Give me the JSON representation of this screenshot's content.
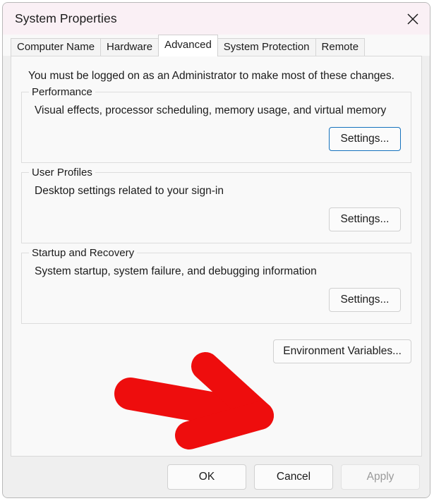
{
  "window": {
    "title": "System Properties",
    "close_icon": "close-icon"
  },
  "tabs": [
    {
      "label": "Computer Name",
      "selected": false
    },
    {
      "label": "Hardware",
      "selected": false
    },
    {
      "label": "Advanced",
      "selected": true
    },
    {
      "label": "System Protection",
      "selected": false
    },
    {
      "label": "Remote",
      "selected": false
    }
  ],
  "panel": {
    "admin_note": "You must be logged on as an Administrator to make most of these changes.",
    "groups": [
      {
        "label": "Performance",
        "description": "Visual effects, processor scheduling, memory usage, and virtual memory",
        "button": "Settings...",
        "focused": true
      },
      {
        "label": "User Profiles",
        "description": "Desktop settings related to your sign-in",
        "button": "Settings...",
        "focused": false
      },
      {
        "label": "Startup and Recovery",
        "description": "System startup, system failure, and debugging information",
        "button": "Settings...",
        "focused": false
      }
    ],
    "environment_variables_button": "Environment Variables..."
  },
  "footer": {
    "ok": "OK",
    "cancel": "Cancel",
    "apply": "Apply",
    "apply_disabled": true
  },
  "annotation": {
    "shape": "arrow-right",
    "color": "#ee0d0d",
    "points_at": "Environment Variables..."
  },
  "colors": {
    "titlebar": "#faf0f5",
    "panel": "#f9f9f9",
    "footer": "#efefef",
    "focus_border": "#1572bd",
    "annotation_red": "#ee0d0d"
  }
}
